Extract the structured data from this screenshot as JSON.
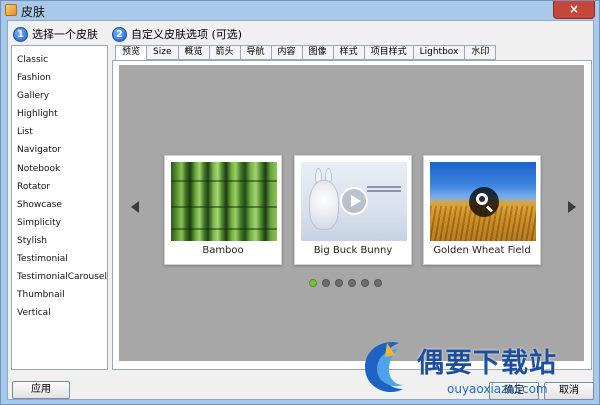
{
  "window": {
    "title": "皮肤",
    "close_label": "×"
  },
  "step1": {
    "number": "1",
    "label": "选择一个皮肤"
  },
  "step2": {
    "number": "2",
    "label": "自定义皮肤选项 (可选)"
  },
  "skins": [
    "Classic",
    "Fashion",
    "Gallery",
    "Highlight",
    "List",
    "Navigator",
    "Notebook",
    "Rotator",
    "Showcase",
    "Simplicity",
    "Stylish",
    "Testimonial",
    "TestimonialCarousel",
    "Thumbnail",
    "Vertical"
  ],
  "tabs": [
    "预览",
    "Size",
    "概览",
    "箭头",
    "导航",
    "内容",
    "图像",
    "样式",
    "项目样式",
    "Lightbox",
    "水印"
  ],
  "active_tab": "预览",
  "preview": {
    "cards": [
      {
        "caption": "Bamboo",
        "overlay_icon": "none"
      },
      {
        "caption": "Big Buck Bunny",
        "overlay_icon": "play-icon"
      },
      {
        "caption": "Golden Wheat Field",
        "overlay_icon": "zoom-icon"
      }
    ],
    "pagination_count": 6,
    "pagination_active": 1,
    "colors": {
      "background": "#a7a7a7",
      "active_dot": "#7ac143"
    }
  },
  "buttons": {
    "apply": "应用",
    "ok": "确定",
    "cancel": "取消"
  },
  "watermark": {
    "title": "偶要下载站",
    "url": "ouyaoxiazai.com"
  }
}
